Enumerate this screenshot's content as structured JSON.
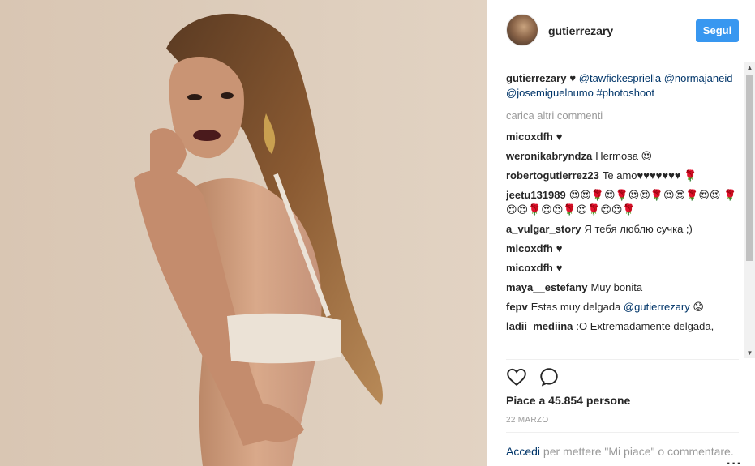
{
  "post": {
    "username": "gutierrezary",
    "follow_label": "Segui",
    "caption": {
      "user": "gutierrezary",
      "heart": "♥",
      "mention1": "@tawfickespriella",
      "mention2": "@normajaneid",
      "mention3": "@josemiguelnumo",
      "hashtag": "#photoshoot"
    },
    "load_more": "carica altri commenti",
    "comments": [
      {
        "user": "micoxdfh",
        "text": "♥"
      },
      {
        "user": "weronikabryndza",
        "text": "Hermosa 😍"
      },
      {
        "user": "robertogutierrez23",
        "text": "Te amo♥♥♥♥♥♥♥ 🌹"
      },
      {
        "user": "jeetu131989",
        "text": "😍😍🌹😍🌹😍😍🌹😍😍🌹😍😍 🌹😍😍🌹😍😍🌹😍🌹😍😍🌹"
      },
      {
        "user": "a_vulgar_story",
        "text": "Я тебя люблю сучка ;)"
      },
      {
        "user": "micoxdfh",
        "text": "♥"
      },
      {
        "user": "micoxdfh",
        "text": "♥"
      },
      {
        "user": "maya__estefany",
        "text": "Muy bonita"
      },
      {
        "user": "fepv",
        "text": "Estas muy delgada ",
        "mention": "@gutierrezary",
        "after": " 😟"
      },
      {
        "user": "ladii_mediina",
        "text": ":O Extremadamente delgada,"
      }
    ],
    "likes": "Piace a 45.854 persone",
    "date": "22 MARZO",
    "login_link": "Accedi",
    "login_text": " per mettere \"Mi piace\" o commentare.",
    "more_label": "···",
    "icons": {
      "like": "heart-icon",
      "comment": "comment-icon"
    },
    "colors": {
      "accent": "#3897f0",
      "mention": "#003569"
    }
  }
}
